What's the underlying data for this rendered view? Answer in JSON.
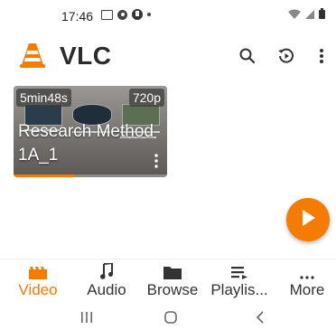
{
  "status_bar": {
    "time": "17:46",
    "icons": [
      "image-icon",
      "gear-icon",
      "circle-app-icon",
      "dot-icon"
    ],
    "right_icons": [
      "wifi-icon",
      "signal-icon",
      "battery-icon"
    ]
  },
  "app_bar": {
    "title": "VLC",
    "logo": "vlc-cone-logo",
    "actions": [
      "search-icon",
      "history-icon",
      "overflow-menu-icon"
    ]
  },
  "video_card": {
    "duration": "5min48s",
    "resolution": "720p",
    "title": "Research Method 1A_1",
    "progress_fraction": 0.4
  },
  "fab": {
    "icon": "play-icon"
  },
  "bottom_nav": {
    "items": [
      {
        "label": "Video",
        "icon": "video-icon",
        "active": true
      },
      {
        "label": "Audio",
        "icon": "music-note-icon",
        "active": false
      },
      {
        "label": "Browse",
        "icon": "folder-icon",
        "active": false
      },
      {
        "label": "Playlis...",
        "icon": "playlist-icon",
        "active": false
      },
      {
        "label": "More",
        "icon": "more-horizontal-icon",
        "active": false
      }
    ]
  },
  "system_nav": [
    "recents-icon",
    "home-icon",
    "back-icon"
  ],
  "colors": {
    "accent": "#f57c00",
    "text": "#2b2b2b"
  }
}
